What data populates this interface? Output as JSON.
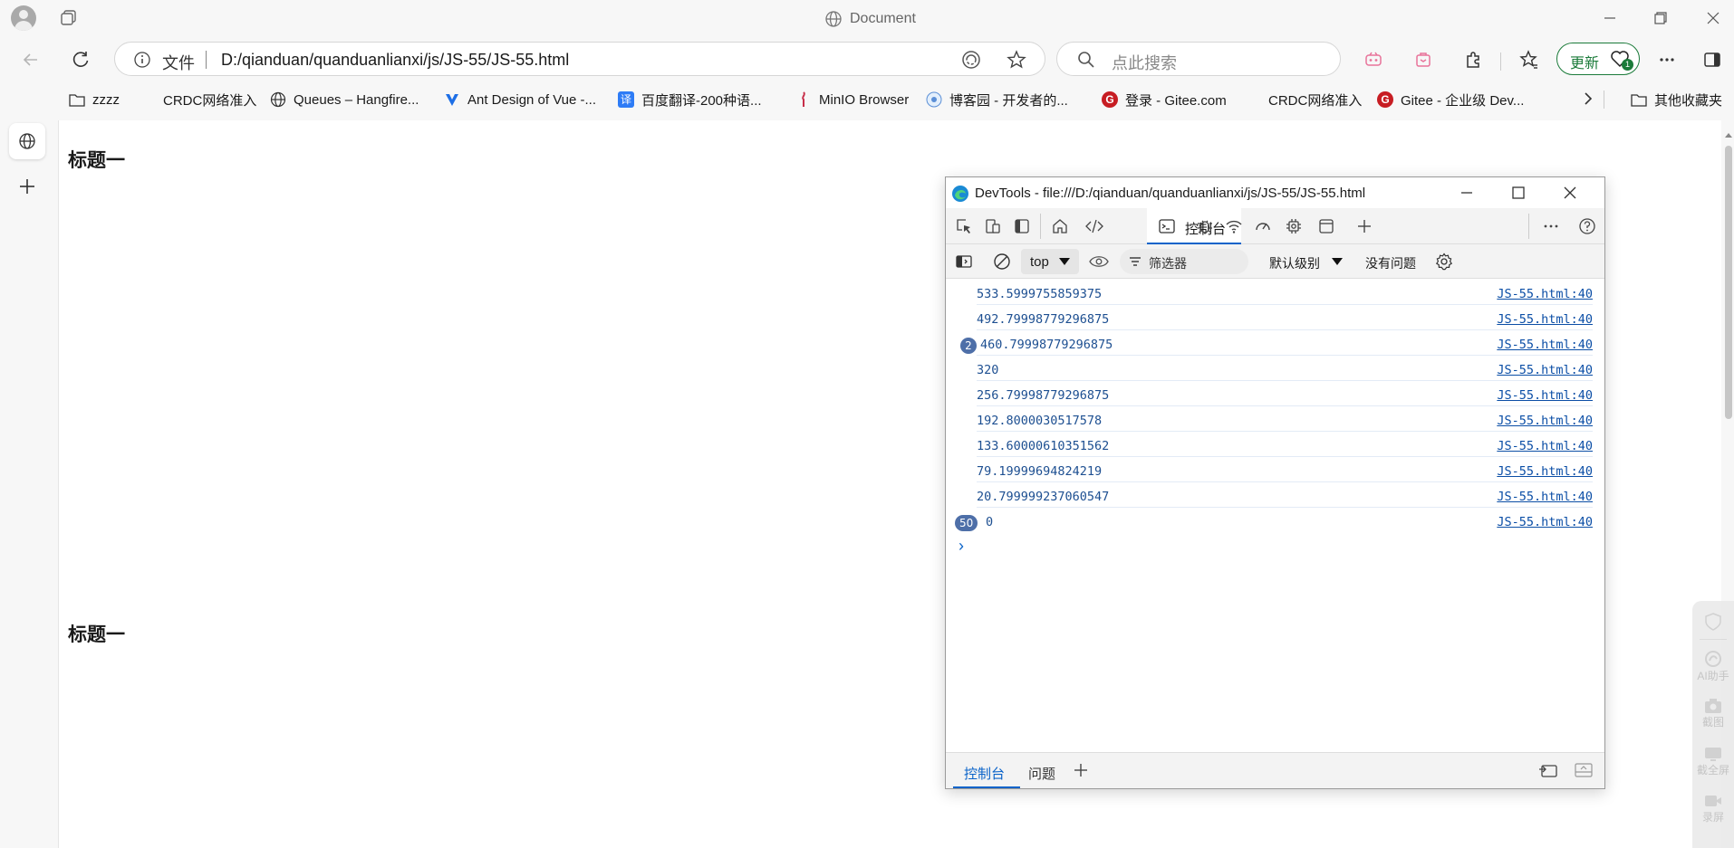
{
  "window": {
    "title": "Document",
    "controls": [
      "minimize",
      "restore",
      "close"
    ]
  },
  "toolbar": {
    "address": {
      "file_label": "文件",
      "url": "D:/qianduan/quanduanlianxi/js/JS-55/JS-55.html"
    },
    "search": {
      "placeholder": "点此搜索"
    },
    "update_label": "更新",
    "update_badge": "1"
  },
  "bookmarks": [
    {
      "label": "zzzz",
      "icon": "folder-icon"
    },
    {
      "label": "CRDC网络准入",
      "icon": ""
    },
    {
      "label": "Queues – Hangfire...",
      "icon": "globe-icon"
    },
    {
      "label": "Ant Design of Vue -...",
      "icon": "antdv-icon"
    },
    {
      "label": "百度翻译-200种语...",
      "icon": "baidu-translate-icon"
    },
    {
      "label": "MinIO Browser",
      "icon": "minio-icon"
    },
    {
      "label": "博客园 - 开发者的...",
      "icon": "cnblogs-icon"
    },
    {
      "label": "登录 - Gitee.com",
      "icon": "gitee-icon"
    },
    {
      "label": "CRDC网络准入",
      "icon": ""
    },
    {
      "label": "Gitee - 企业级 Dev...",
      "icon": "gitee-icon"
    }
  ],
  "bookmarks_other": "其他收藏夹",
  "page": {
    "heading1": "标题一",
    "heading2": "标题一"
  },
  "right_rail": [
    {
      "label": "AI助手",
      "icon": "ai-assistant-icon"
    },
    {
      "label": "截图",
      "icon": "camera-icon"
    },
    {
      "label": "截全屏",
      "icon": "fullscreen-capture-icon"
    },
    {
      "label": "录屏",
      "icon": "record-icon"
    }
  ],
  "devtools": {
    "title": "DevTools - file:///D:/qianduan/quanduanlianxi/js/JS-55/JS-55.html",
    "active_tab": "控制台",
    "context": "top",
    "filter_placeholder": "筛选器",
    "level": "默认级别",
    "issues": "没有问题",
    "logs": [
      {
        "value": "533.5999755859375",
        "source": "JS-55.html:40",
        "count": ""
      },
      {
        "value": "492.79998779296875",
        "source": "JS-55.html:40",
        "count": ""
      },
      {
        "value": "460.79998779296875",
        "source": "JS-55.html:40",
        "count": "2"
      },
      {
        "value": "320",
        "source": "JS-55.html:40",
        "count": ""
      },
      {
        "value": "256.79998779296875",
        "source": "JS-55.html:40",
        "count": ""
      },
      {
        "value": "192.8000030517578",
        "source": "JS-55.html:40",
        "count": ""
      },
      {
        "value": "133.60000610351562",
        "source": "JS-55.html:40",
        "count": ""
      },
      {
        "value": "79.19999694824219",
        "source": "JS-55.html:40",
        "count": ""
      },
      {
        "value": "20.799999237060547",
        "source": "JS-55.html:40",
        "count": ""
      },
      {
        "value": "0",
        "source": "JS-55.html:40",
        "count": "50"
      }
    ],
    "prompt": "›",
    "drawer_tabs": [
      "控制台",
      "问题"
    ]
  },
  "colors": {
    "accent": "#0a63c9",
    "update_green": "#1b7b3a",
    "log_value": "#1d4f91",
    "badge": "#4e6fa8"
  }
}
